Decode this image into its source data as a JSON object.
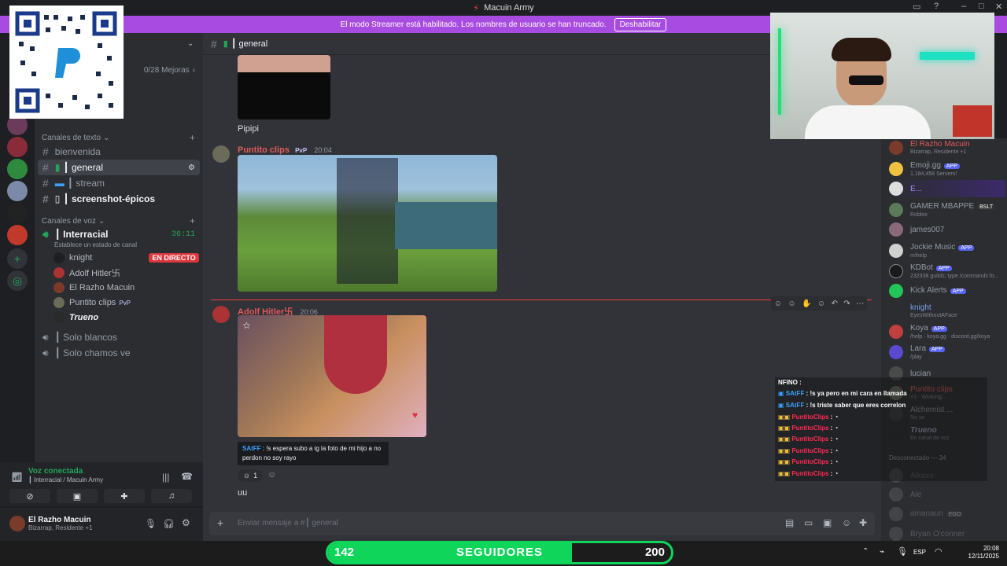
{
  "window": {
    "title": "Macuin Army"
  },
  "banner": {
    "text": "El modo Streamer está habilitado. Los nombres de usuario se han truncado.",
    "button": "Deshabilitar"
  },
  "server": {
    "boosts": "0/28 Mejoras"
  },
  "sidebar": {
    "text_category": "Canales de texto",
    "voice_category": "Canales de voz",
    "text_channels": [
      {
        "name": "bienvenida"
      },
      {
        "name": "┃ general"
      },
      {
        "name": "┃ stream"
      },
      {
        "name": "┃ screenshot-épicos"
      }
    ],
    "voice_channels": [
      {
        "name": "┃ Interracial",
        "timer": "36:11",
        "status": "Establece un estado de canal"
      },
      {
        "name": "┃ Solo blancos"
      },
      {
        "name": "┃ Solo chamos ve"
      }
    ],
    "voice_users": [
      {
        "name": "knight",
        "badge": "EN DIRECTO"
      },
      {
        "name": "Adolf Hitler卐"
      },
      {
        "name": "El Razho Macuin"
      },
      {
        "name": "Puntito clips",
        "tag": "PvP"
      },
      {
        "name": "Trueno"
      }
    ]
  },
  "voice_panel": {
    "status": "Voz conectada",
    "location": "┃ Interracial / Macuin Army"
  },
  "user_panel": {
    "name": "El Razho Macuin",
    "status": "Bizarrap, Residente +1"
  },
  "chat": {
    "channel_name": "┃ general",
    "input_placeholder": "Enviar mensaje a #┃ general",
    "messages": [
      {
        "text": "Pipipi"
      },
      {
        "author": "Puntito clips",
        "tag": "PvP",
        "time": "20:04"
      },
      {
        "author": "Adolf Hitler卐",
        "time": "20:06"
      },
      {
        "embed_user": "SAtFF",
        "embed_text": "!s espera subo a ig la foto de mi hijo a no perdon no soy rayo"
      },
      {
        "reaction_count": "1"
      },
      {
        "text": "uu"
      }
    ]
  },
  "members": {
    "online": [
      {
        "name": "El Razho Macuin",
        "sub": "Bizarrap, Residente +1",
        "color": "#e05a5a"
      },
      {
        "name": "Emoji.gg",
        "sub": "1,184,458 Servers!",
        "badge": "APP"
      },
      {
        "name": "E...",
        "sub": ""
      },
      {
        "name": "GAMER MBAPPE",
        "sub": "Roblox",
        "badge": "BSLT"
      },
      {
        "name": "james007",
        "sub": ""
      },
      {
        "name": "Jockie Music",
        "sub": "m!help",
        "badge": "APP"
      },
      {
        "name": "KDBot",
        "sub": "232338 guilds; type /commands fo...",
        "badge": "APP"
      },
      {
        "name": "Kick Alerts",
        "sub": "",
        "badge": "APP"
      },
      {
        "name": "knight",
        "sub": "EyesWithoutAFace",
        "color": "#7a9cf0"
      },
      {
        "name": "Koya",
        "sub": "/help · koya.gg · discord.gg/koya",
        "badge": "APP"
      },
      {
        "name": "Lara",
        "sub": "/play",
        "badge": "APP"
      },
      {
        "name": "lucian",
        "sub": ""
      },
      {
        "name": "Puntito clips",
        "sub": "+1 · Working...",
        "color": "#e05a5a"
      },
      {
        "name": "Alchemist ...",
        "sub": "No se"
      },
      {
        "name": "Trueno",
        "sub": "En canal de voz"
      }
    ],
    "offline_header": "Desconectado — 34",
    "offline": [
      {
        "name": "Aikaxe"
      },
      {
        "name": "Ale"
      },
      {
        "name": "amanaun",
        "tag": "EGO"
      },
      {
        "name": "Bryan O'conner"
      }
    ]
  },
  "stream_overlay": {
    "chat": [
      {
        "user": "NFINO",
        "text": "",
        "color": "#ffffff"
      },
      {
        "user": "SAtFF",
        "text": "!s ya pero en mi cara en llamada",
        "color": "#3ea0ff"
      },
      {
        "user": "SAtFF",
        "text": "!s triste saber que eres correlon",
        "color": "#3ea0ff"
      },
      {
        "user": "PuntitoClips",
        "text": "",
        "color": "#ff2a55"
      },
      {
        "user": "PuntitoClips",
        "text": "",
        "color": "#ff2a55"
      },
      {
        "user": "PuntitoClips",
        "text": "",
        "color": "#ff2a55"
      },
      {
        "user": "PuntitoClips",
        "text": "",
        "color": "#ff2a55"
      },
      {
        "user": "PuntitoClips",
        "text": "",
        "color": "#ff2a55"
      },
      {
        "user": "PuntitoClips",
        "text": "",
        "color": "#ff2a55"
      }
    ],
    "followers": {
      "current": "142",
      "label": "SEGUIDORES",
      "goal": "200",
      "progress": 0.71
    }
  },
  "taskbar": {
    "lang": "ESP",
    "time": "20:08",
    "date": "12/11/2025"
  },
  "colors": {
    "accent": "#5865f2",
    "streamer_banner": "#a84be0",
    "online": "#23a559",
    "follow_bar": "#0fd65b"
  }
}
